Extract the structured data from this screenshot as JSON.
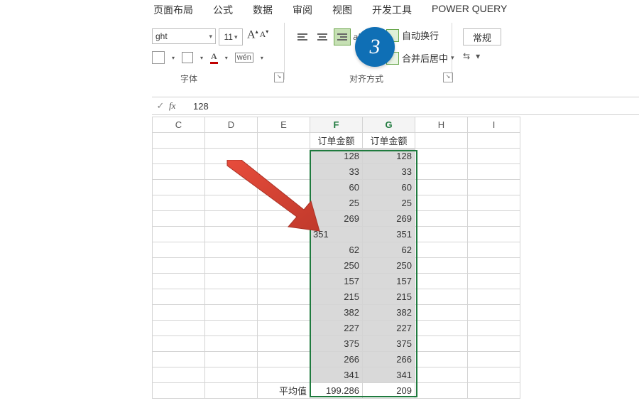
{
  "tabs": {
    "t0": "页面布局",
    "t1": "公式",
    "t2": "数据",
    "t3": "审阅",
    "t4": "视图",
    "t5": "开发工具",
    "t6": "POWER QUERY"
  },
  "ribbon": {
    "font_name": "ght",
    "font_size": "11",
    "group_font": "字体",
    "group_align": "对齐方式",
    "wrap_text": "自动换行",
    "merge_center": "合并后居中",
    "number_format": "常规",
    "wen": "wén"
  },
  "step": "3",
  "formula_bar": {
    "ok": "✓",
    "fx": "fx",
    "value": "128"
  },
  "headers": {
    "C": "C",
    "D": "D",
    "E": "E",
    "F": "F",
    "G": "G",
    "H": "H",
    "I": "I"
  },
  "col_title_F": "订单金额",
  "col_title_G": "订单金额",
  "average_label": "平均值",
  "rows": [
    {
      "f": "128",
      "g": "128",
      "f_left": false
    },
    {
      "f": "33",
      "g": "33",
      "f_left": false
    },
    {
      "f": "60",
      "g": "60",
      "f_left": false
    },
    {
      "f": "25",
      "g": "25",
      "f_left": false
    },
    {
      "f": "269",
      "g": "269",
      "f_left": false
    },
    {
      "f": "351",
      "g": "351",
      "f_left": true
    },
    {
      "f": "62",
      "g": "62",
      "f_left": false
    },
    {
      "f": "250",
      "g": "250",
      "f_left": false
    },
    {
      "f": "157",
      "g": "157",
      "f_left": false
    },
    {
      "f": "215",
      "g": "215",
      "f_left": false
    },
    {
      "f": "382",
      "g": "382",
      "f_left": false
    },
    {
      "f": "227",
      "g": "227",
      "f_left": false
    },
    {
      "f": "375",
      "g": "375",
      "f_left": false
    },
    {
      "f": "266",
      "g": "266",
      "f_left": false
    },
    {
      "f": "341",
      "g": "341",
      "f_left": false
    }
  ],
  "avg": {
    "f": "199.286",
    "g": "209"
  },
  "chart_data": {
    "type": "table",
    "title": "订单金额",
    "columns": [
      "订单金额(F)",
      "订单金额(G)"
    ],
    "rows": [
      [
        128,
        128
      ],
      [
        33,
        33
      ],
      [
        60,
        60
      ],
      [
        25,
        25
      ],
      [
        269,
        269
      ],
      [
        "351 (text)",
        351
      ],
      [
        62,
        62
      ],
      [
        250,
        250
      ],
      [
        157,
        157
      ],
      [
        215,
        215
      ],
      [
        382,
        382
      ],
      [
        227,
        227
      ],
      [
        375,
        375
      ],
      [
        266,
        266
      ],
      [
        341,
        341
      ]
    ],
    "summary": {
      "label": "平均值",
      "F": 199.286,
      "G": 209
    }
  }
}
